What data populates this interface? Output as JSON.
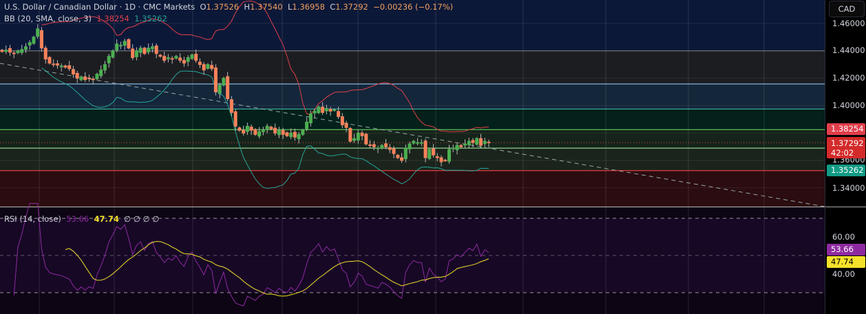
{
  "header": {
    "symbol": "U.S. Dollar / Canadian Dollar · 1D · CMC Markets",
    "o_label": "O",
    "o": "1.37526",
    "h_label": "H",
    "h": "1.37540",
    "l_label": "L",
    "l": "1.36958",
    "c_label": "C",
    "c": "1.37292",
    "change": "−0.00236 (−0.17%)"
  },
  "bb": {
    "label": "BB (20, SMA, close, 3)",
    "upper": "1.38254",
    "lower": "1.35262"
  },
  "rsi": {
    "label": "RSI (14, close)",
    "value": "53.66",
    "ma": "47.74",
    "extras": [
      "∅",
      "∅",
      "∅",
      "∅"
    ]
  },
  "axis": {
    "currency": "CAD",
    "price_ticks": [
      "1.46000",
      "1.44000",
      "1.42000",
      "1.40000",
      "1.36000",
      "1.34000"
    ],
    "rsi_ticks": [
      "60.00",
      "40.00"
    ],
    "tags": {
      "bb_upper": "1.38254",
      "last": "1.37292",
      "countdown": "42:02",
      "bb_lower": "1.35262",
      "rsi": "53.66",
      "rsi_ma": "47.74"
    }
  },
  "colors": {
    "up": "#4caf50",
    "down": "#f7825b",
    "bb_upper": "#e0404a",
    "bb_lower": "#26a69a",
    "rsi": "#8e2aa0",
    "rsi_ma": "#f5e12a"
  },
  "chart_data": {
    "type": "candlestick",
    "title": "USDCAD 1D",
    "ylim": [
      1.33,
      1.475
    ],
    "rsi_ylim": [
      20,
      80
    ],
    "closes": [
      1.4395,
      1.4405,
      1.439,
      1.438,
      1.44,
      1.441,
      1.443,
      1.446,
      1.45,
      1.456,
      1.442,
      1.434,
      1.431,
      1.43,
      1.4295,
      1.429,
      1.428,
      1.427,
      1.423,
      1.42,
      1.421,
      1.419,
      1.42,
      1.419,
      1.423,
      1.426,
      1.43,
      1.436,
      1.44,
      1.445,
      1.444,
      1.447,
      1.442,
      1.435,
      1.44,
      1.442,
      1.438,
      1.442,
      1.443,
      1.438,
      1.436,
      1.433,
      1.435,
      1.434,
      1.436,
      1.433,
      1.431,
      1.435,
      1.437,
      1.433,
      1.43,
      1.426,
      1.43,
      1.427,
      1.41,
      1.415,
      1.42,
      1.405,
      1.395,
      1.385,
      1.382,
      1.38,
      1.385,
      1.382,
      1.379,
      1.381,
      1.382,
      1.385,
      1.383,
      1.38,
      1.382,
      1.379,
      1.378,
      1.38,
      1.377,
      1.379,
      1.382,
      1.388,
      1.394,
      1.396,
      1.399,
      1.395,
      1.398,
      1.396,
      1.397,
      1.392,
      1.386,
      1.384,
      1.374,
      1.376,
      1.38,
      1.378,
      1.372,
      1.371,
      1.37,
      1.369,
      1.371,
      1.37,
      1.368,
      1.365,
      1.362,
      1.36,
      1.369,
      1.372,
      1.374,
      1.373,
      1.373,
      1.362,
      1.368,
      1.364,
      1.362,
      1.359,
      1.36,
      1.368,
      1.369,
      1.371,
      1.37,
      1.372,
      1.374,
      1.373,
      1.376,
      1.371,
      1.374,
      1.37292
    ],
    "zones": [
      1.44,
      1.4158,
      1.3975,
      1.3825,
      1.369,
      1.3526
    ]
  }
}
